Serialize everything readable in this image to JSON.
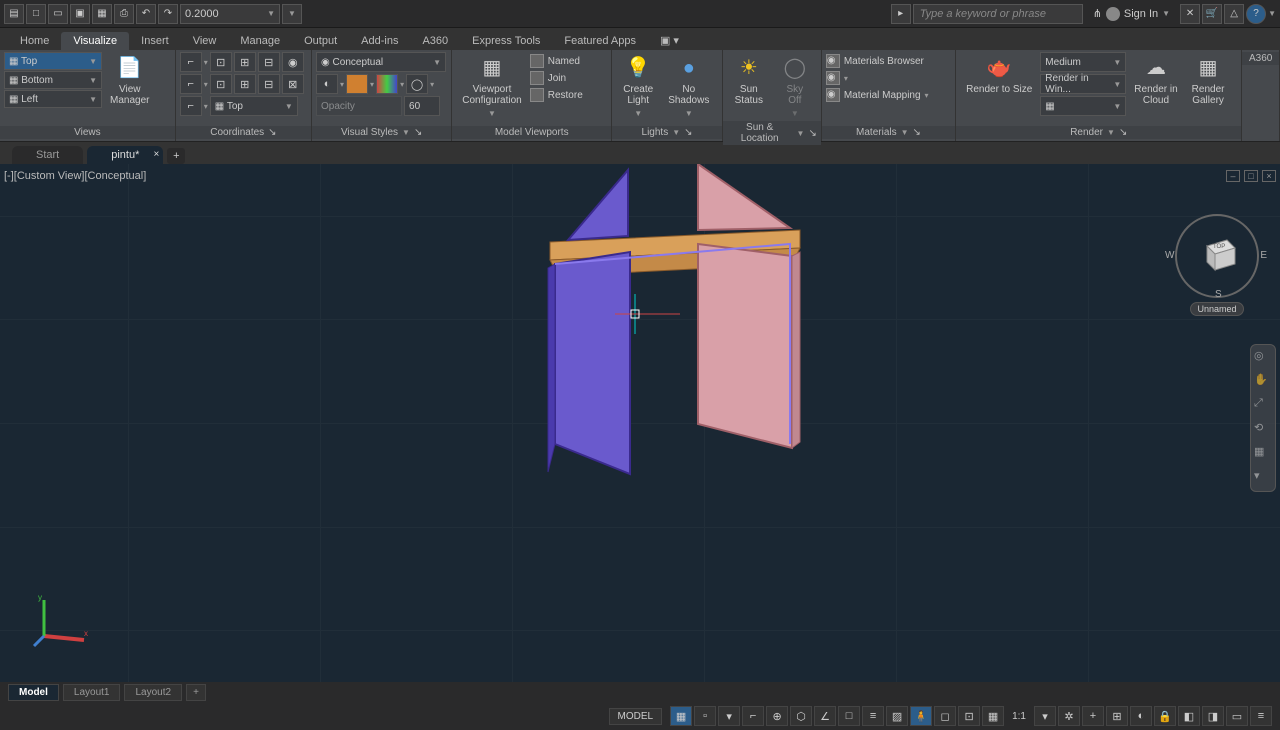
{
  "qat": {
    "scale_value": "0.2000",
    "search_placeholder": "Type a keyword or phrase",
    "signin": "Sign In"
  },
  "ribbon_tabs": [
    "Home",
    "Visualize",
    "Insert",
    "View",
    "Manage",
    "Output",
    "Add-ins",
    "A360",
    "Express Tools",
    "Featured Apps"
  ],
  "active_ribbon_tab": "Visualize",
  "panels": {
    "views": {
      "title": "Views",
      "items": [
        "Top",
        "Bottom",
        "Left"
      ],
      "manager": "View\nManager"
    },
    "coordinates": {
      "title": "Coordinates",
      "ucs_combo": "Top"
    },
    "visual_styles": {
      "title": "Visual Styles",
      "combo": "Conceptual",
      "opacity_label": "Opacity",
      "opacity_value": "60"
    },
    "model_viewports": {
      "title": "Model Viewports",
      "config": "Viewport\nConfiguration",
      "named": "Named",
      "join": "Join",
      "restore": "Restore"
    },
    "lights": {
      "title": "Lights",
      "create": "Create\nLight",
      "noshadows": "No\nShadows",
      "sky": "Sky Off"
    },
    "sun": {
      "title": "Sun & Location",
      "sunstatus": "Sun\nStatus"
    },
    "materials": {
      "title": "Materials",
      "browser": "Materials Browser",
      "mapping": "Material Mapping"
    },
    "render": {
      "title": "Render",
      "size": "Render to Size",
      "quality": "Medium",
      "render_in": "Render in Win...",
      "cloud": "Render in\nCloud",
      "gallery": "Render\nGallery"
    },
    "a360": {
      "title": "A360"
    }
  },
  "file_tabs": {
    "start": "Start",
    "doc": "pintu*"
  },
  "viewport": {
    "label": "[-][Custom View][Conceptual]",
    "unnamed": "Unnamed",
    "vc_top": "TOP",
    "vc_w": "W",
    "vc_e": "E",
    "vc_s": "S"
  },
  "layout_tabs": [
    "Model",
    "Layout1",
    "Layout2"
  ],
  "status": {
    "model": "MODEL",
    "ratio": "1:1"
  }
}
